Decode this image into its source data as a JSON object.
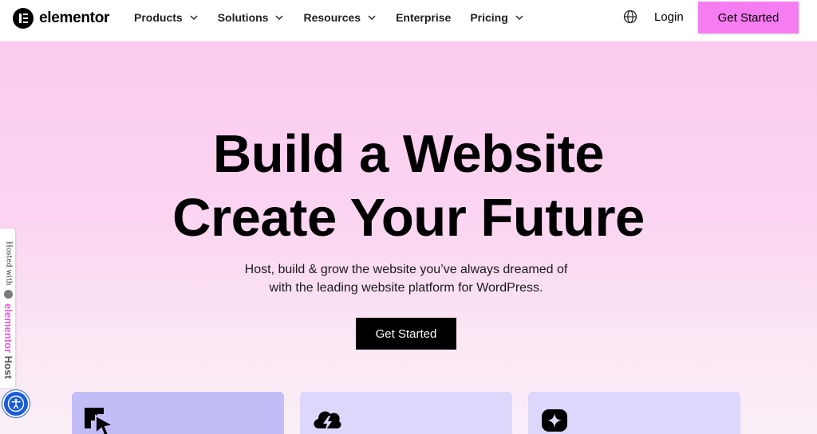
{
  "header": {
    "logo_text": "elementor",
    "nav": [
      {
        "label": "Products",
        "has_dropdown": true
      },
      {
        "label": "Solutions",
        "has_dropdown": true
      },
      {
        "label": "Resources",
        "has_dropdown": true
      },
      {
        "label": "Enterprise",
        "has_dropdown": false
      },
      {
        "label": "Pricing",
        "has_dropdown": true
      }
    ],
    "language_icon": "globe-icon",
    "login_label": "Login",
    "cta_label": "Get Started"
  },
  "hero": {
    "title_line1": "Build a Website",
    "title_line2": "Create Your Future",
    "subtitle_line1": "Host, build & grow the website you’ve always dreamed of",
    "subtitle_line2": "with the leading website platform for WordPress.",
    "cta_label": "Get Started"
  },
  "cards": [
    {
      "icon": "cursor-sparkle-icon"
    },
    {
      "icon": "cloud-lightning-icon"
    },
    {
      "icon": "sparkle-grid-icon"
    }
  ],
  "side_badge": {
    "hosted_text": "Hosted with",
    "brand_part1": "elementor",
    "brand_part2": "Host"
  },
  "accessibility": {
    "icon": "accessibility-icon"
  },
  "colors": {
    "accent_pink": "#f67cf1",
    "hero_gradient_top": "#fbc9ef",
    "hero_gradient_bottom": "#faeff6",
    "card_purple_dark": "#c2bcf7",
    "card_purple_light": "#dcd7fb",
    "a11y_blue": "#1a5bd6"
  }
}
